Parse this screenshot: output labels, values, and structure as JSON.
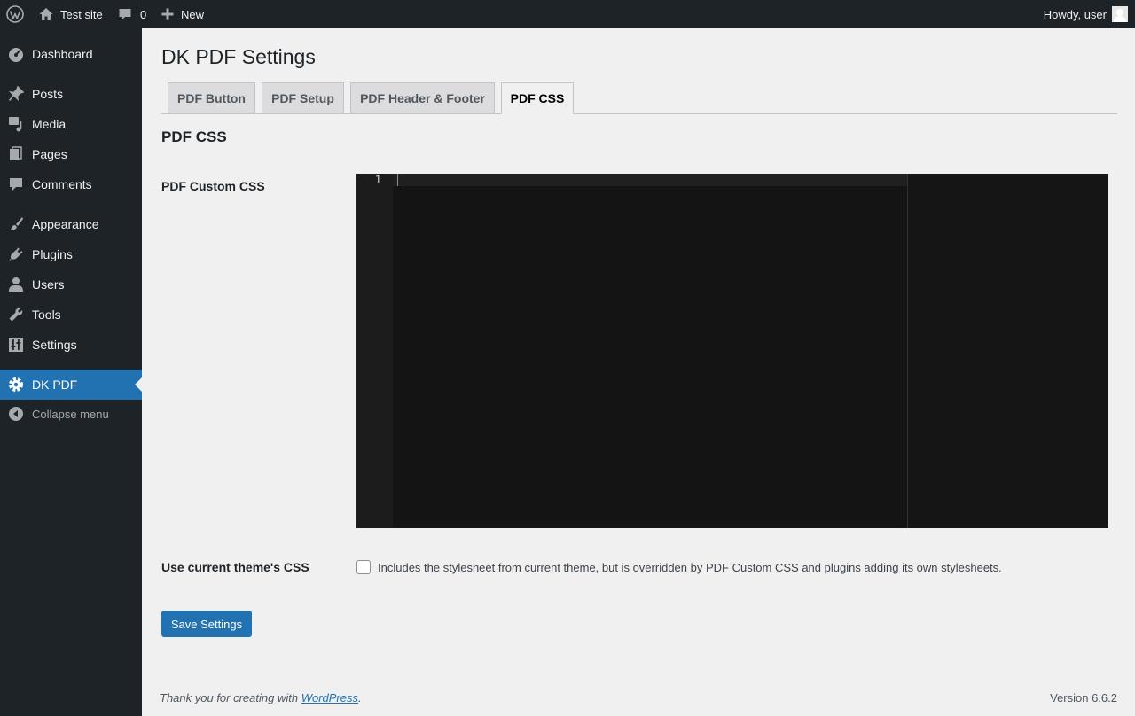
{
  "admin_bar": {
    "site_name": "Test site",
    "comments_count": "0",
    "new_label": "New",
    "account_label": "Howdy, user"
  },
  "sidebar": {
    "items": [
      {
        "label": "Dashboard",
        "icon": "dashboard-icon"
      },
      {
        "label": "Posts",
        "icon": "pin-icon"
      },
      {
        "label": "Media",
        "icon": "media-icon"
      },
      {
        "label": "Pages",
        "icon": "pages-icon"
      },
      {
        "label": "Comments",
        "icon": "comment-icon"
      },
      {
        "label": "Appearance",
        "icon": "brush-icon"
      },
      {
        "label": "Plugins",
        "icon": "plugin-icon"
      },
      {
        "label": "Users",
        "icon": "user-icon"
      },
      {
        "label": "Tools",
        "icon": "wrench-icon"
      },
      {
        "label": "Settings",
        "icon": "settings-icon"
      },
      {
        "label": "DK PDF",
        "icon": "gear-icon",
        "current": true
      }
    ],
    "collapse_label": "Collapse menu"
  },
  "main": {
    "title": "DK PDF Settings",
    "tabs": [
      {
        "label": "PDF Button"
      },
      {
        "label": "PDF Setup"
      },
      {
        "label": "PDF Header & Footer"
      },
      {
        "label": "PDF CSS",
        "active": true
      }
    ],
    "section_title": "PDF CSS",
    "custom_css_label": "PDF Custom CSS",
    "editor": {
      "line_numbers": [
        "1"
      ],
      "content": ""
    },
    "theme_css_label": "Use current theme's CSS",
    "theme_css_checked": false,
    "theme_css_description": "Includes the stylesheet from current theme, but is overridden by PDF Custom CSS and plugins adding its own stylesheets.",
    "save_label": "Save Settings"
  },
  "footer": {
    "thanks_prefix": "Thank you for creating with ",
    "thanks_link": "WordPress",
    "thanks_suffix": ".",
    "version": "Version 6.6.2"
  },
  "colors": {
    "admin_bar_bg": "#1d2327",
    "sidebar_bg": "#1d2327",
    "accent": "#2271b1",
    "page_bg": "#f0f0f1",
    "editor_bg": "#141414"
  }
}
